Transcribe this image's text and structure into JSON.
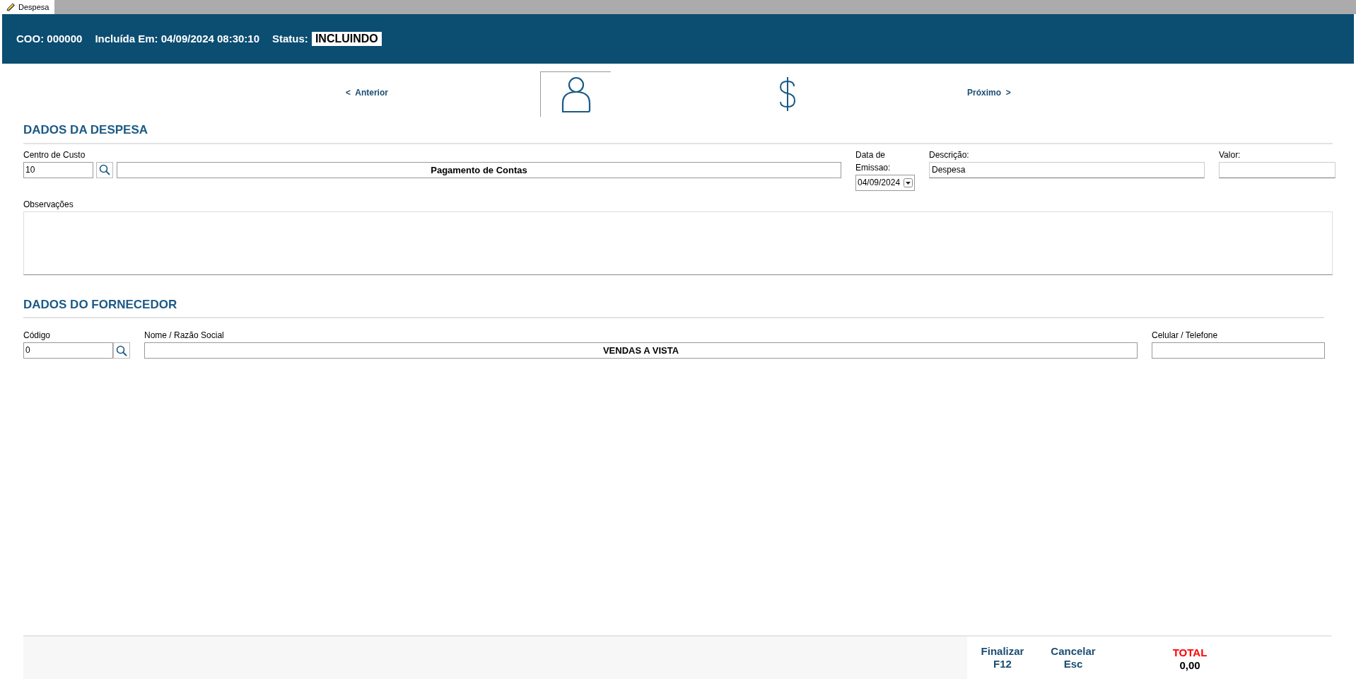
{
  "window": {
    "tab": "Despesa"
  },
  "header": {
    "coo_label": "COO:",
    "coo": "000000",
    "included_label": "Incluída Em:",
    "included": "04/09/2024 08:30:10",
    "status_label": "Status:",
    "status": "INCLUINDO"
  },
  "nav": {
    "previous": "<  Anterior",
    "next": "Próximo  >",
    "steps": [
      {
        "kind": "person",
        "selected": true
      },
      {
        "kind": "dollar",
        "selected": false
      }
    ]
  },
  "expense": {
    "title": "DADOS DA DESPESA",
    "cost_center_label": "Centro de Custo",
    "cost_center_code": "10",
    "cost_center_name": "Pagamento de Contas",
    "issue_date_label": "Data de Emissao:",
    "issue_date": "04/09/2024",
    "description_label": "Descrição:",
    "description": "Despesa",
    "value_label": "Valor:",
    "notes_label": "Observações"
  },
  "supplier": {
    "title": "DADOS DO FORNECEDOR",
    "code_label": "Código",
    "code": "0",
    "name_label": "Nome / Razão Social",
    "name": "VENDAS A VISTA",
    "phone_label": "Celular / Telefone"
  },
  "footer": {
    "finish": [
      "Finalizar",
      "F12"
    ],
    "cancel": [
      "Cancelar",
      "Esc"
    ],
    "total_label": "TOTAL",
    "total": "0,00"
  }
}
